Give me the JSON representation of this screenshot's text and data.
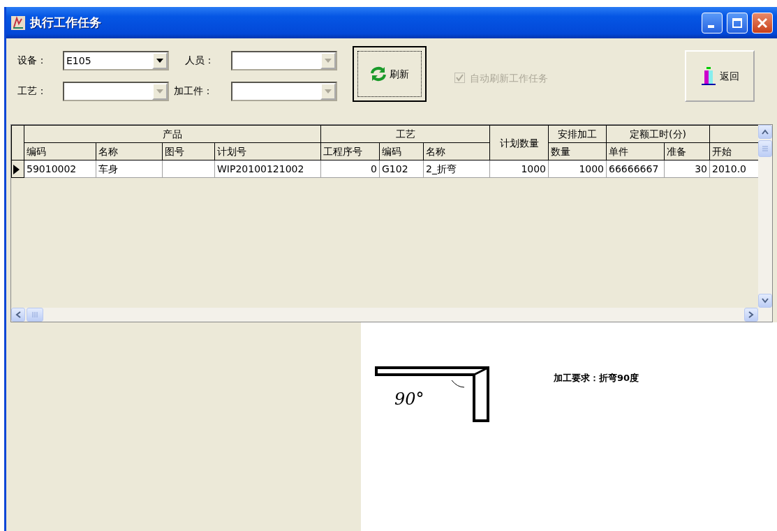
{
  "window": {
    "title": "执行工作任务"
  },
  "filters": [
    {
      "label": "设备：",
      "value": "E105",
      "disabled": false
    },
    {
      "label": "人员：",
      "disabled": true
    },
    {
      "label": "工艺：",
      "disabled": true
    },
    {
      "label": "加工件：",
      "disabled": true
    }
  ],
  "refresh_button": {
    "label": "刷新"
  },
  "auto_refresh": {
    "label": "自动刷新工作任务",
    "checked": true,
    "disabled": true
  },
  "back_button": {
    "label": "返回"
  },
  "table": {
    "column_groups": [
      {
        "label": "产品",
        "columns": [
          "编码",
          "名称",
          "图号",
          "计划号"
        ]
      },
      {
        "label": "工艺",
        "columns": [
          "工程序号",
          "编码",
          "名称"
        ]
      },
      {
        "label": "计划数量"
      },
      {
        "label": "安排加工",
        "columns": [
          "数量"
        ]
      },
      {
        "label": "定额工时(分)",
        "columns": [
          "单件",
          "准备"
        ]
      },
      {
        "columns": [
          "开始"
        ]
      }
    ],
    "rows": [
      {
        "selected": true,
        "cells": [
          "59010002",
          "车身",
          null,
          "WIP20100121002",
          "0",
          "G102",
          "2_折弯",
          "1000",
          "1000",
          "66666667",
          "30",
          "2010.0"
        ]
      }
    ]
  },
  "drawing": {
    "sketch_label": "90°",
    "note": "加工要求：折弯90度"
  }
}
